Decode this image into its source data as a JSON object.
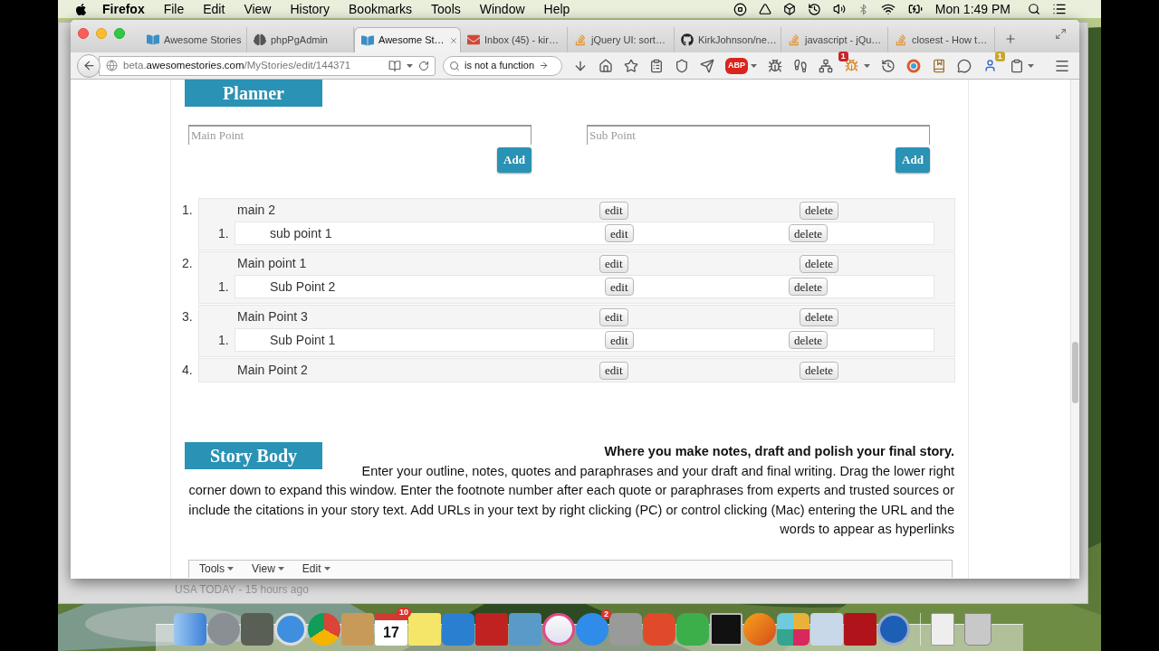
{
  "menubar": {
    "app": "Firefox",
    "menus": [
      "File",
      "Edit",
      "View",
      "History",
      "Bookmarks",
      "Tools",
      "Window",
      "Help"
    ],
    "clock": "Mon 1:49 PM"
  },
  "browser": {
    "tabs": [
      {
        "title": "Awesome Stories",
        "selected": false
      },
      {
        "title": "phpPgAdmin",
        "selected": false
      },
      {
        "title": "Awesome St…",
        "selected": true
      },
      {
        "title": "Inbox (45) - kir…",
        "selected": false
      },
      {
        "title": "jQuery UI: sort…",
        "selected": false
      },
      {
        "title": "KirkJohnson/ne…",
        "selected": false
      },
      {
        "title": "javascript - jQu…",
        "selected": false
      },
      {
        "title": "closest - How t…",
        "selected": false
      }
    ],
    "url": {
      "prefix": "beta.",
      "domain": "awesomestories.com",
      "path": "/MyStories/edit/144371"
    },
    "search": {
      "value": "is not a function"
    },
    "abp": "ABP",
    "badges": [
      "1",
      "1"
    ]
  },
  "planner": {
    "title": "Planner",
    "main_input": {
      "placeholder": "Main Point"
    },
    "sub_input": {
      "placeholder": "Sub Point"
    },
    "add_buttons": [
      "Add",
      "Add"
    ],
    "points": [
      {
        "number": "1.",
        "text": "main 2",
        "edit": "edit",
        "delete": "delete",
        "children": [
          {
            "number": "1.",
            "text": "sub point 1",
            "edit": "edit",
            "delete": "delete"
          }
        ]
      },
      {
        "number": "2.",
        "text": "Main point 1",
        "edit": "edit",
        "delete": "delete",
        "children": [
          {
            "number": "1.",
            "text": "Sub Point 2",
            "edit": "edit",
            "delete": "delete"
          }
        ]
      },
      {
        "number": "3.",
        "text": "Main Point 3",
        "edit": "edit",
        "delete": "delete",
        "children": [
          {
            "number": "1.",
            "text": "Sub Point 1",
            "edit": "edit",
            "delete": "delete"
          }
        ]
      },
      {
        "number": "4.",
        "text": "Main Point 2",
        "edit": "edit",
        "delete": "delete"
      }
    ]
  },
  "story_body": {
    "title": "Story Body",
    "lead": "Where you make notes, draft and polish your final story.",
    "text": "Enter your outline, notes, quotes and paraphrases and your draft and final writing. Drag the lower right corner down to expand this window. Enter the footnote number after each quote or paraphrases from experts and trusted sources or include the citations in your story text. Add URLs in your text by right clicking (PC) or control clicking (Mac) entering the URL and the words to appear as hyperlinks",
    "editor_menus": [
      "Tools",
      "View",
      "Edit"
    ]
  },
  "background_window": {
    "caption": "USA TODAY - 15 hours ago"
  },
  "dock": {
    "calendar_date": "17",
    "calendar_badge": "10",
    "app_store_badge": "2"
  }
}
